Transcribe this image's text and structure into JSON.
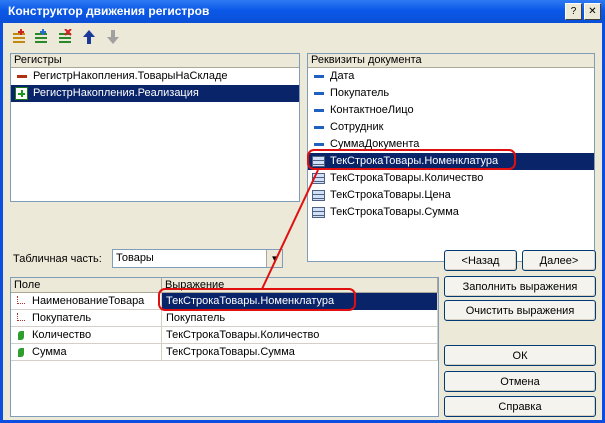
{
  "window": {
    "title": "Конструктор движения регистров"
  },
  "titlebar": {
    "help_glyph": "?",
    "close_glyph": "✕"
  },
  "registers": {
    "header": "Регистры",
    "items": [
      {
        "label": "РегистрНакопления.ТоварыНаСкладе"
      },
      {
        "label": "РегистрНакопления.Реализация"
      }
    ]
  },
  "doc_attrs": {
    "header": "Реквизиты документа",
    "items": [
      {
        "label": "Дата"
      },
      {
        "label": "Покупатель"
      },
      {
        "label": "КонтактноеЛицо"
      },
      {
        "label": "Сотрудник"
      },
      {
        "label": "СуммаДокумента"
      },
      {
        "label": "ТекСтрокаТовары.Номенклатура"
      },
      {
        "label": "ТекСтрокаТовары.Количество"
      },
      {
        "label": "ТекСтрокаТовары.Цена"
      },
      {
        "label": "ТекСтрокаТовары.Сумма"
      }
    ]
  },
  "tabular": {
    "label": "Табличная часть:",
    "value": "Товары"
  },
  "grid": {
    "col_field": "Поле",
    "col_expr": "Выражение",
    "rows": [
      {
        "field": "НаименованиеТовара",
        "expr": "ТекСтрокаТовары.Номенклатура"
      },
      {
        "field": "Покупатель",
        "expr": "Покупатель"
      },
      {
        "field": "Количество",
        "expr": "ТекСтрокаТовары.Количество"
      },
      {
        "field": "Сумма",
        "expr": "ТекСтрокаТовары.Сумма"
      }
    ]
  },
  "buttons": {
    "back": "<Назад",
    "next": "Далее>",
    "fill": "Заполнить выражения",
    "clear": "Очистить выражения",
    "ok": "ОК",
    "cancel": "Отмена",
    "help": "Справка"
  },
  "colors": {
    "selection": "#0a246a",
    "highlight": "#e01010",
    "titlebar": "#0b58e8"
  }
}
